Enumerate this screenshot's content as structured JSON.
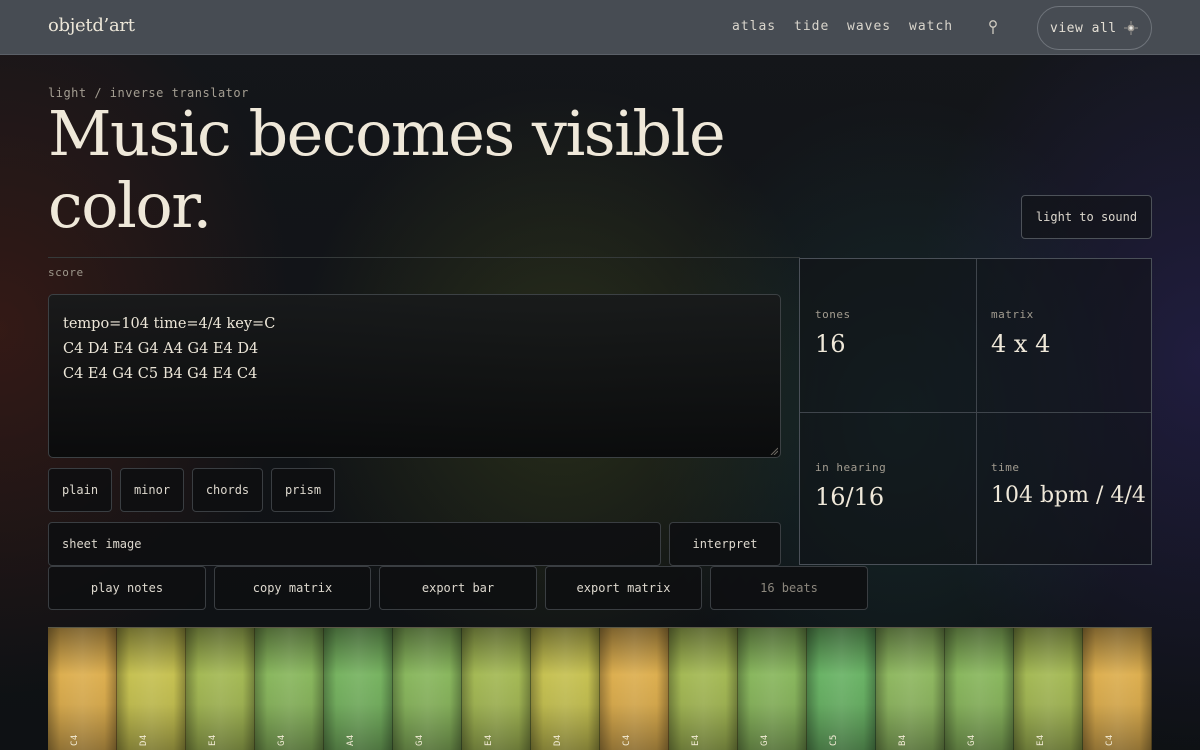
{
  "header": {
    "brand": "objetd’art",
    "nav": [
      "atlas",
      "tide",
      "waves",
      "watch"
    ],
    "view_all_label": "view all"
  },
  "hero": {
    "breadcrumb": "light / inverse translator",
    "title_line1": "Music becomes visible",
    "title_line2": "color.",
    "mode_button": "light to sound"
  },
  "score": {
    "label": "score",
    "lines": [
      "tempo=104 time=4/4 key=C",
      "C4 D4 E4 G4 A4 G4 E4 D4",
      "C4 E4 G4 C5 B4 G4 E4 C4"
    ]
  },
  "presets": [
    "plain",
    "minor",
    "chords",
    "prism"
  ],
  "sheet": {
    "placeholder": "sheet image",
    "interpret_label": "interpret"
  },
  "actions": [
    "play notes",
    "copy matrix",
    "export bar",
    "export matrix"
  ],
  "beats_label": "16 beats",
  "stats": {
    "tones_label": "tones",
    "tones_value": "16",
    "matrix_label": "matrix",
    "matrix_value": "4 x 4",
    "hearing_label": "in hearing",
    "hearing_value": "16/16",
    "time_label": "time",
    "time_value": "104 bpm / 4/4"
  },
  "colorbar": {
    "notes": [
      "C4",
      "D4",
      "E4",
      "G4",
      "A4",
      "G4",
      "E4",
      "D4",
      "C4",
      "E4",
      "G4",
      "C5",
      "B4",
      "G4",
      "E4",
      "C4"
    ],
    "colors": {
      "C4": "#cda24a",
      "D4": "#b7b34c",
      "E4": "#98ab4f",
      "G4": "#7fa957",
      "A4": "#6ea65a",
      "B4": "#84aa5a",
      "C5": "#62a65e"
    }
  },
  "theme": {
    "accent_text": "#efe8d9",
    "topbar": "#474c53"
  }
}
